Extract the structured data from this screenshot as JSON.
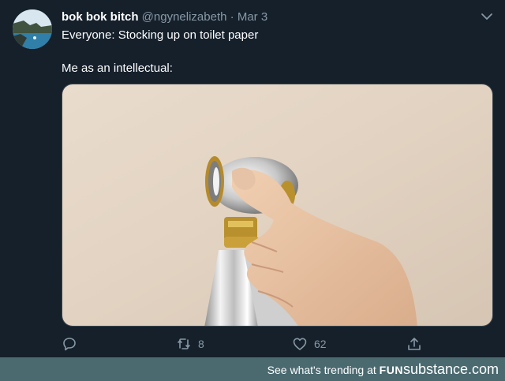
{
  "tweet": {
    "display_name": "bok bok bitch",
    "handle": "@ngynelizabeth",
    "separator": "·",
    "date": "Mar 3",
    "text_line1": "Everyone: Stocking up on toilet paper",
    "text_line2": "Me as an intellectual:"
  },
  "actions": {
    "reply_icon": "reply-icon",
    "retweet_icon": "retweet-icon",
    "retweet_count": "8",
    "like_icon": "heart-icon",
    "like_count": "62",
    "share_icon": "share-icon"
  },
  "footer": {
    "text": "See what's trending at",
    "brand_part1": "FUN",
    "brand_part2": "substance.com"
  },
  "colors": {
    "background": "#15202b",
    "text_primary": "#ffffff",
    "text_secondary": "#8899a6",
    "footer_bg": "#4a6a70"
  }
}
